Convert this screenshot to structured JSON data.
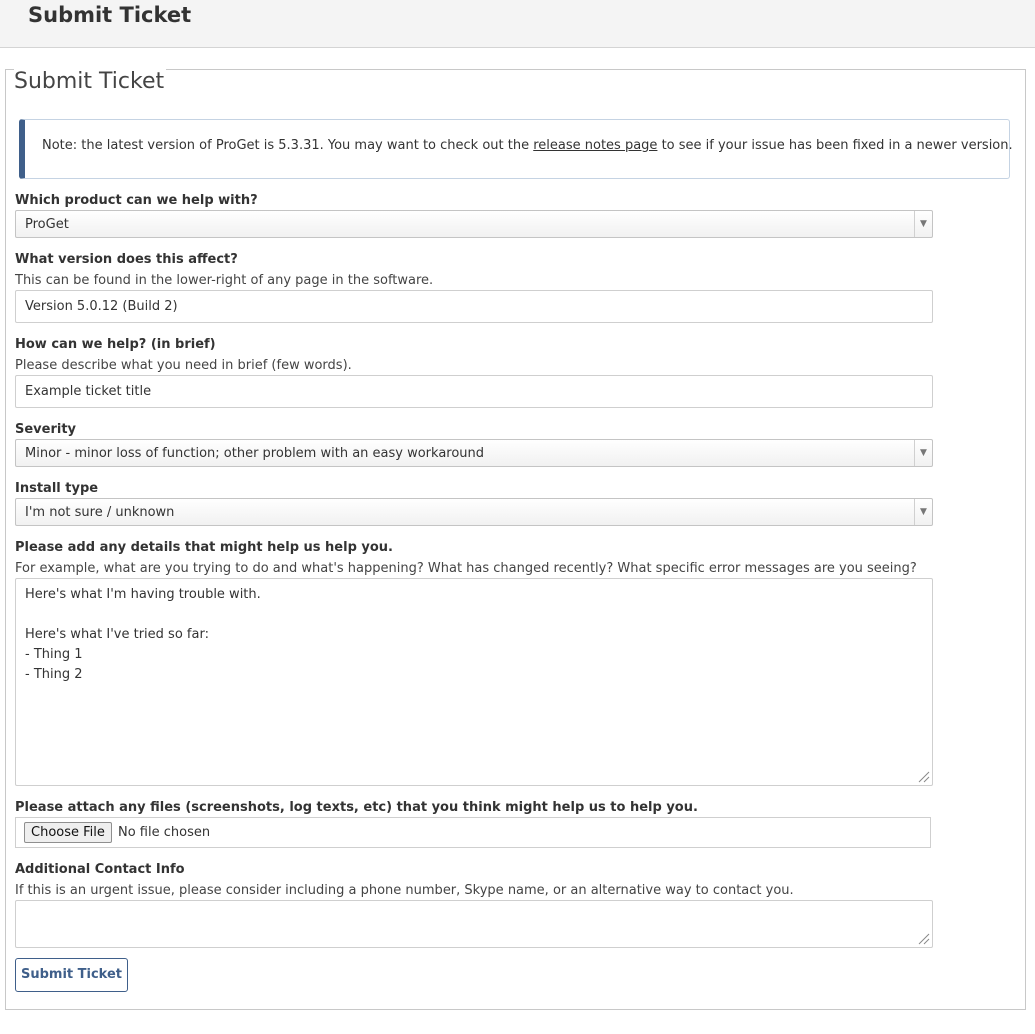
{
  "header": {
    "title": "Submit Ticket"
  },
  "form": {
    "legend": "Submit Ticket",
    "note": {
      "before": "Note: the latest version of ProGet is 5.3.31. You may want to check out the ",
      "link": "release notes page",
      "after": " to see if your issue has been fixed in a newer version."
    },
    "product": {
      "label": "Which product can we help with?",
      "value": "ProGet"
    },
    "version": {
      "label": "What version does this affect?",
      "hint": "This can be found in the lower-right of any page in the software.",
      "value": "Version 5.0.12 (Build 2)"
    },
    "brief": {
      "label": "How can we help? (in brief)",
      "hint": "Please describe what you need in brief (few words).",
      "value": "Example ticket title"
    },
    "severity": {
      "label": "Severity",
      "value": "Minor - minor loss of function; other problem with an easy workaround"
    },
    "install_type": {
      "label": "Install type",
      "value": "I'm not sure / unknown"
    },
    "details": {
      "label": "Please add any details that might help us help you.",
      "hint": "For example, what are you trying to do and what's happening? What has changed recently? What specific error messages are you seeing?",
      "lines": [
        "Here's what I'm having trouble with.",
        "",
        "Here's what I've tried so far:",
        "- Thing 1",
        "- Thing 2"
      ]
    },
    "attach": {
      "label": "Please attach any files (screenshots, log texts, etc) that you think might help us to help you.",
      "button": "Choose File",
      "status": "No file chosen"
    },
    "contact": {
      "label": "Additional Contact Info",
      "hint": "If this is an urgent issue, please consider including a phone number, Skype name, or an alternative way to contact you.",
      "value": ""
    },
    "submit_label": "Submit Ticket"
  },
  "colors": {
    "accent": "#3f5f8a",
    "topbar_bg": "#f4f4f4",
    "note_border": "#c5d3e3"
  },
  "icons": {
    "select_arrow": "chevron-down-icon",
    "resize_grip": "resize-grip-icon"
  }
}
